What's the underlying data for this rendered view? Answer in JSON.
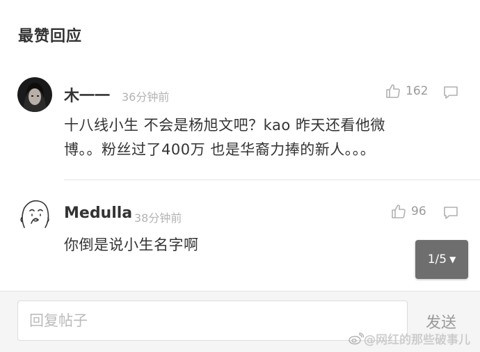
{
  "section_title": "最赞回应",
  "comments": [
    {
      "author": "木一一",
      "time": "36分钟前",
      "likes": "162",
      "content_lines": [
        "十八线小生  不会是杨旭文吧？kao 昨天还看他微",
        "博。。粉丝过了400万 也是华裔力捧的新人。。。"
      ]
    },
    {
      "author": "Medulla",
      "time": "38分钟前",
      "likes": "96",
      "content_lines": [
        "你倒是说小生名字啊"
      ]
    }
  ],
  "pager": {
    "label": "1/5"
  },
  "reply": {
    "placeholder": "回复帖子",
    "send_label": "发送"
  },
  "watermark": {
    "text": "@网红的那些破事儿"
  },
  "colors": {
    "text": "#333333",
    "muted": "#999999",
    "time": "#b3b3b3",
    "pager_bg": "#6e6e6e"
  }
}
